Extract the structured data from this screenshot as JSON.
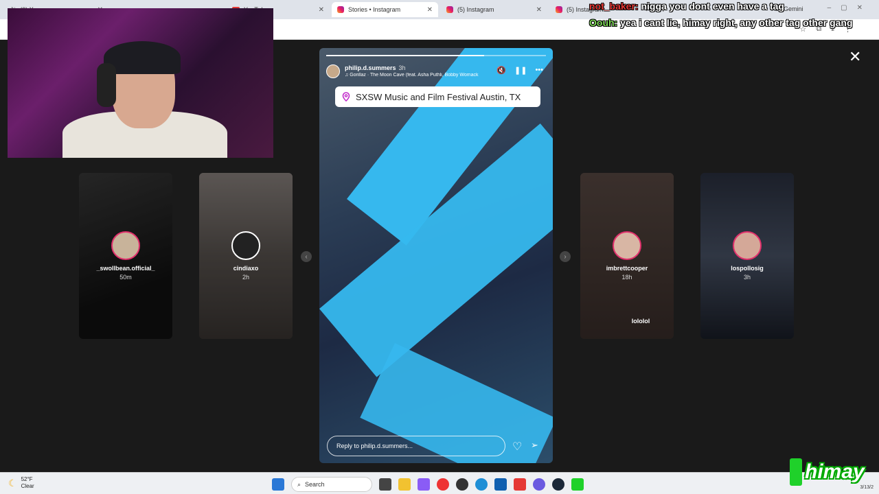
{
  "browser": {
    "tabs": [
      {
        "label": "(0) X",
        "icon": "x-icon"
      },
      {
        "label": "YouTube",
        "icon": "youtube-icon"
      },
      {
        "label": "Stories • Instagram",
        "icon": "instagram-icon",
        "active": true
      },
      {
        "label": "(5) Instagram",
        "icon": "instagram-icon"
      },
      {
        "label": "(5) Instagram",
        "icon": "instagram-icon"
      }
    ],
    "ask_gemini": "Ask Gemini"
  },
  "story": {
    "username": "philip.d.summers",
    "time_ago": "3h",
    "music": "Gorillaz · The Moon Cave (feat. Asha Puthli, Bobby Womack",
    "location": "SXSW Music and Film Festival Austin, TX",
    "reply_placeholder": "Reply to philip.d.summers...",
    "progress_fraction": 0.72
  },
  "side_stories": [
    {
      "username": "_swollbean.official_",
      "time_ago": "50m",
      "extra": ""
    },
    {
      "username": "cindiaxo",
      "time_ago": "2h",
      "extra": ""
    },
    {
      "username": "imbrettcooper",
      "time_ago": "18h",
      "extra": "lololol"
    },
    {
      "username": "lospollosig",
      "time_ago": "3h",
      "extra": ""
    }
  ],
  "chat": {
    "line1_name": "not_baker:",
    "line1_msg": "nigga you dont even have a tag",
    "line2_name": "Oouh:",
    "line2_msg": "yea i cant lie, himay right, any other tag other gang"
  },
  "taskbar": {
    "temperature": "52°F",
    "condition": "Clear",
    "search_label": "Search",
    "date": "3/13/2"
  },
  "overlay_logo": "himay",
  "colors": {
    "story_accent": "#36b8ee",
    "ring": "#e1306c",
    "chat_name1": "#e53935",
    "chat_name2": "#7ed957",
    "logo_green": "#1fd12a"
  }
}
